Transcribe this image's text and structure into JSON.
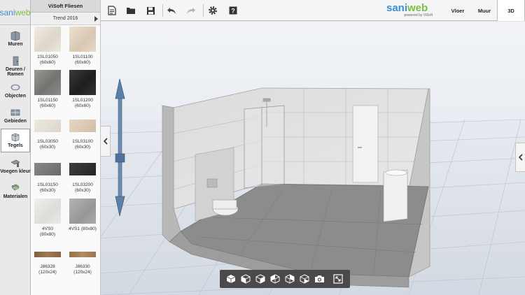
{
  "app": {
    "logo_main": "sani",
    "logo_accent": "web"
  },
  "sidebar": {
    "items": [
      {
        "label": "Muren"
      },
      {
        "label": "Deuren / Ramen"
      },
      {
        "label": "Objecten"
      },
      {
        "label": "Gebieden"
      },
      {
        "label": "Tegels",
        "active": true
      },
      {
        "label": "Voegen kleur"
      },
      {
        "label": "Materialen"
      }
    ]
  },
  "panel": {
    "title": "ViSoft Fliesen",
    "collection": "Trend 2016",
    "tiles": [
      {
        "code": "1SL01050",
        "size": "(60x60)",
        "color": "#e8e2d8"
      },
      {
        "code": "1SL01100",
        "size": "(60x60)",
        "color": "#e4d5c2"
      },
      {
        "code": "1SL01150",
        "size": "(60x60)",
        "color": "#8a8886"
      },
      {
        "code": "1SL01200",
        "size": "(60x60)",
        "color": "#2a2a2a"
      },
      {
        "code": "1SL03050",
        "size": "(60x30)",
        "color": "#e3ddd2"
      },
      {
        "code": "1SL03100",
        "size": "(60x30)",
        "color": "#dbc9b3"
      },
      {
        "code": "1SL03150",
        "size": "(60x30)",
        "color": "#7d7b79"
      },
      {
        "code": "1SL03200",
        "size": "(60x30)",
        "color": "#333333"
      },
      {
        "code": "4VS0",
        "size": "(80x80)",
        "color": "#e9e8e6"
      },
      {
        "code": "4VS1",
        "size": "(80x80)",
        "color": "#a9a8a6"
      },
      {
        "code": "J86328",
        "size": "(120x24)",
        "color": "#8e6a4a"
      },
      {
        "code": "J86330",
        "size": "(120x24)",
        "color": "#9f7b55"
      }
    ]
  },
  "toolbar": {
    "brand_main": "sani",
    "brand_accent": "web",
    "brand_sub": "powered by ViSoft",
    "views": [
      {
        "label": "Vloer"
      },
      {
        "label": "Muur"
      },
      {
        "label": "3D",
        "active": true
      }
    ],
    "icons": [
      "new-document-icon",
      "open-folder-icon",
      "save-icon",
      "undo-icon",
      "redo-icon",
      "settings-icon",
      "help-icon"
    ]
  },
  "bottom_bar": {
    "icons": [
      "view-cube-top-icon",
      "view-cube-front-icon",
      "view-cube-left-icon",
      "view-cube-right-icon",
      "view-cube-back-icon",
      "view-cube-iso-icon",
      "camera-icon",
      "fullscreen-icon"
    ]
  },
  "colors": {
    "brand_blue": "#3a8fd0",
    "brand_green": "#7ac043",
    "toolbar_dark": "#4a4a4a"
  }
}
